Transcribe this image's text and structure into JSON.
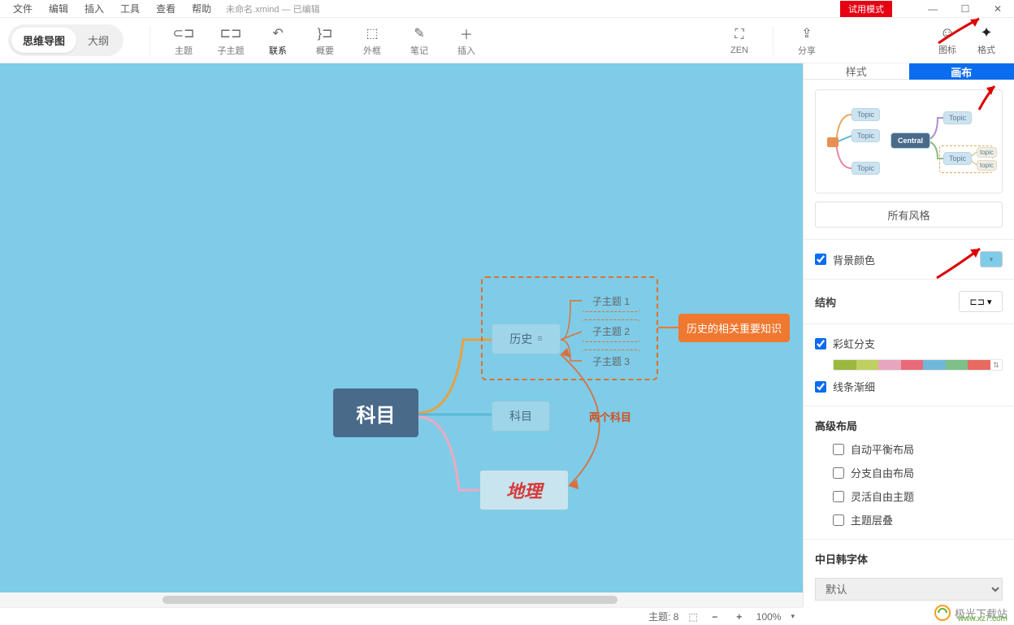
{
  "menu": {
    "file": "文件",
    "edit": "编辑",
    "insert": "插入",
    "tools": "工具",
    "view": "查看",
    "help": "帮助"
  },
  "filename": "未命名.xmind  — 已编辑",
  "trial": "试用模式",
  "viewToggle": {
    "mindmap": "思维导图",
    "outline": "大纲"
  },
  "tools": {
    "topic": "主题",
    "subtopic": "子主题",
    "relation": "联系",
    "summary": "概要",
    "boundary": "外框",
    "note": "笔记",
    "insert": "插入",
    "zen": "ZEN",
    "share": "分享",
    "icon": "图标",
    "format": "格式"
  },
  "map": {
    "central": "科目",
    "history": "历史",
    "subject2": "科目",
    "geo": "地理",
    "sub1": "子主题 1",
    "sub2": "子主题 2",
    "sub3": "子主题 3",
    "callout": "历史的相关重要知识",
    "relLabel": "两个科目"
  },
  "panel": {
    "tabStyle": "样式",
    "tabCanvas": "画布",
    "preview": {
      "central": "Central",
      "topic": "Topic",
      "topicSmall": "topic"
    },
    "allStyles": "所有风格",
    "bgColor": "背景颜色",
    "structure": "结构",
    "rainbow": "彩虹分支",
    "taper": "线条渐细",
    "advLayout": "高级布局",
    "autoBalance": "自动平衡布局",
    "freeBranch": "分支自由布局",
    "freeTopic": "灵活自由主题",
    "overlap": "主题层叠",
    "cjkFont": "中日韩字体",
    "fontDefault": "默认",
    "rainbowColors": [
      "#9cb83e",
      "#c0d060",
      "#e8a5c0",
      "#e86a78",
      "#6fb8d8",
      "#7dc088",
      "#e86a60"
    ]
  },
  "status": {
    "topicCount": "主题: 8",
    "zoom": "100%"
  }
}
